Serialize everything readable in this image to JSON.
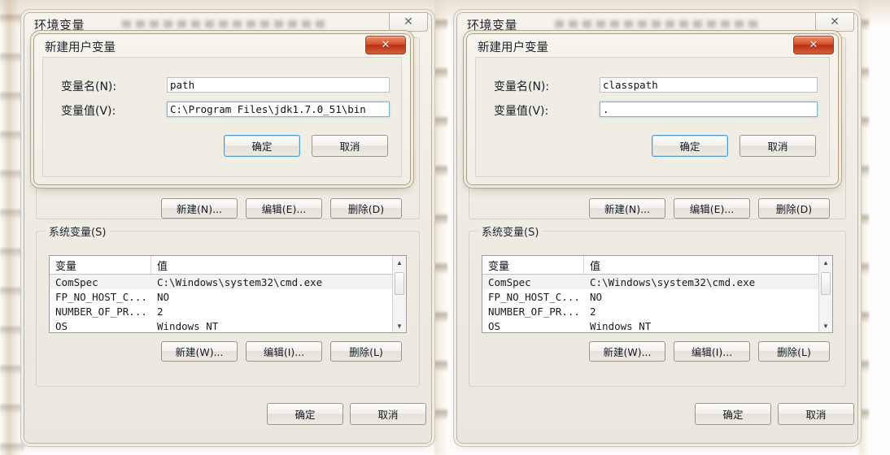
{
  "windows": [
    {
      "id": "left",
      "title": "环境变量",
      "close_glyph": "✕",
      "modal": {
        "title": "新建用户变量",
        "close_glyph": "✕",
        "fields": [
          {
            "label": "变量名(N):",
            "value": "path",
            "focused": false
          },
          {
            "label": "变量值(V):",
            "value": "C:\\Program Files\\jdk1.7.0_51\\bin",
            "focused": true
          }
        ],
        "buttons": [
          {
            "label": "确定",
            "focus": true
          },
          {
            "label": "取消",
            "focus": false
          }
        ]
      },
      "user_buttons": [
        {
          "label": "新建(N)..."
        },
        {
          "label": "编辑(E)..."
        },
        {
          "label": "删除(D)"
        }
      ],
      "system_group": {
        "legend": "系统变量(S)",
        "columns": [
          "变量",
          "值"
        ],
        "rows": [
          {
            "name": "ComSpec",
            "value": "C:\\Windows\\system32\\cmd.exe",
            "alt": true
          },
          {
            "name": "FP_NO_HOST_C...",
            "value": "NO",
            "alt": false
          },
          {
            "name": "NUMBER_OF_PR...",
            "value": "2",
            "alt": false
          },
          {
            "name": "OS",
            "value": "Windows NT",
            "alt": false
          }
        ],
        "scroll_up_glyph": "▲",
        "scroll_down_glyph": "▼"
      },
      "system_buttons": [
        {
          "label": "新建(W)..."
        },
        {
          "label": "编辑(I)..."
        },
        {
          "label": "删除(L)"
        }
      ],
      "footer_buttons": [
        {
          "label": "确定"
        },
        {
          "label": "取消"
        }
      ]
    },
    {
      "id": "right",
      "title": "环境变量",
      "close_glyph": "✕",
      "modal": {
        "title": "新建用户变量",
        "close_glyph": "✕",
        "fields": [
          {
            "label": "变量名(N):",
            "value": "classpath",
            "focused": false
          },
          {
            "label": "变量值(V):",
            "value": ".",
            "focused": true
          }
        ],
        "buttons": [
          {
            "label": "确定",
            "focus": true
          },
          {
            "label": "取消",
            "focus": false
          }
        ]
      },
      "user_buttons": [
        {
          "label": "新建(N)..."
        },
        {
          "label": "编辑(E)..."
        },
        {
          "label": "删除(D)"
        }
      ],
      "system_group": {
        "legend": "系统变量(S)",
        "columns": [
          "变量",
          "值"
        ],
        "rows": [
          {
            "name": "ComSpec",
            "value": "C:\\Windows\\system32\\cmd.exe",
            "alt": true
          },
          {
            "name": "FP_NO_HOST_C...",
            "value": "NO",
            "alt": false
          },
          {
            "name": "NUMBER_OF_PR...",
            "value": "2",
            "alt": false
          },
          {
            "name": "OS",
            "value": "Windows NT",
            "alt": false
          }
        ],
        "scroll_up_glyph": "▲",
        "scroll_down_glyph": "▼"
      },
      "system_buttons": [
        {
          "label": "新建(W)..."
        },
        {
          "label": "编辑(I)..."
        },
        {
          "label": "删除(L)"
        }
      ],
      "footer_buttons": [
        {
          "label": "确定"
        },
        {
          "label": "取消"
        }
      ]
    }
  ],
  "colors": {
    "window_face": "#efece4",
    "modal_frame": "#b8a98c",
    "close_red": "#ba2f11",
    "focus_blue": "#4f9ccd",
    "row_alt": "#f2f2f2"
  }
}
